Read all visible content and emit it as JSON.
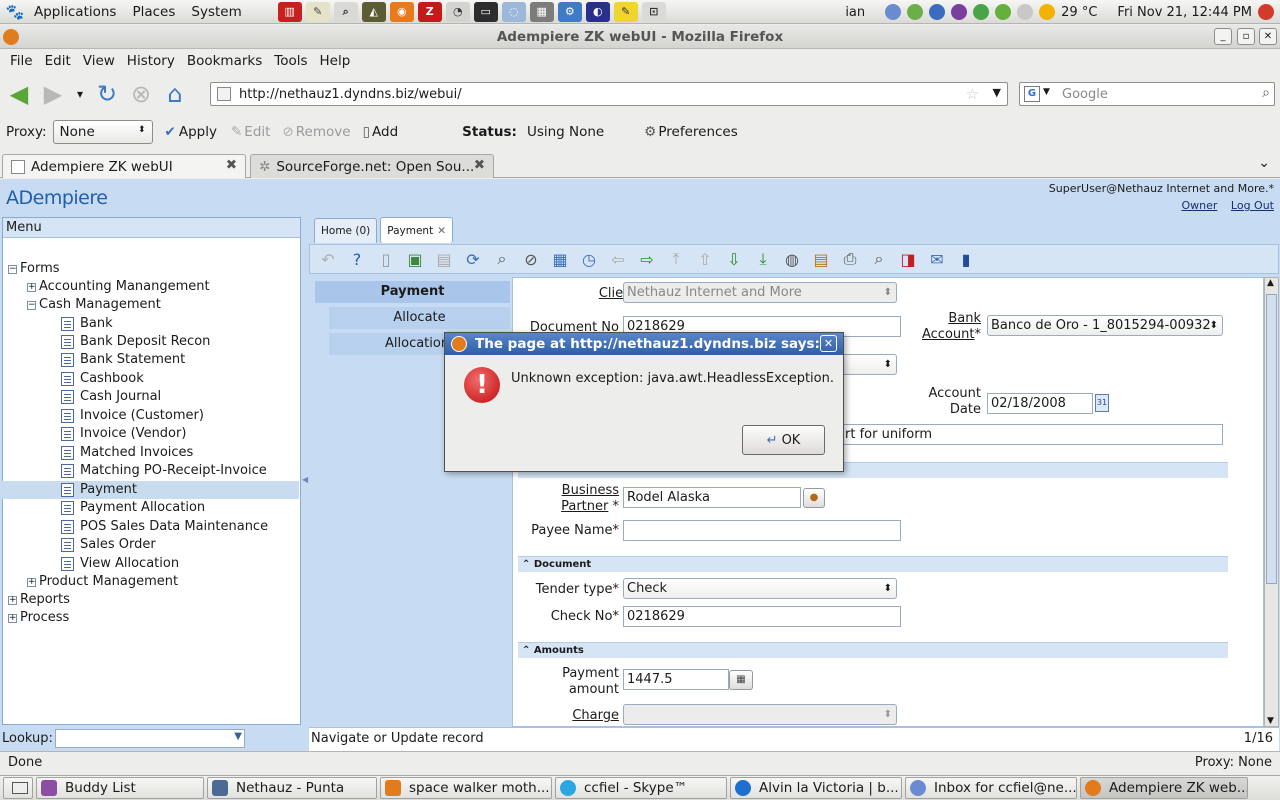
{
  "gnome_panel": {
    "menus": [
      "Applications",
      "Places",
      "System"
    ],
    "user": "ian",
    "weather": "29 °C",
    "clock": "Fri Nov 21, 12:44 PM"
  },
  "window": {
    "title": "Adempiere ZK webUI - Mozilla Firefox"
  },
  "firefox": {
    "menu": [
      "File",
      "Edit",
      "View",
      "History",
      "Bookmarks",
      "Tools",
      "Help"
    ],
    "url": "http://nethauz1.dyndns.biz/webui/",
    "search_placeholder": "Google",
    "proxy": {
      "label": "Proxy:",
      "value": "None",
      "apply": "Apply",
      "edit": "Edit",
      "remove": "Remove",
      "add": "Add",
      "status_label": "Status:",
      "status_value": "Using None",
      "preferences": "Preferences"
    },
    "tabs": [
      "Adempiere ZK webUI",
      "SourceForge.net: Open Sou..."
    ],
    "status_left": "Done",
    "status_right": "Proxy: None"
  },
  "adempiere": {
    "logo": "ADempiere",
    "user_line": "SuperUser@Nethauz Internet and More.*",
    "owner": "Owner",
    "logout": "Log Out",
    "menu_title": "Menu",
    "tree": {
      "forms": "Forms",
      "accounting": "Accounting Manangement",
      "cash": "Cash Management",
      "items": [
        "Bank",
        "Bank Deposit Recon",
        "Bank Statement",
        "Cashbook",
        "Cash Journal",
        "Invoice (Customer)",
        "Invoice (Vendor)",
        "Matched Invoices",
        "Matching PO-Receipt-Invoice",
        "Payment",
        "Payment Allocation",
        "POS Sales Data Maintenance",
        "Sales Order",
        "View Allocation"
      ],
      "product": "Product Management",
      "reports": "Reports",
      "process": "Process"
    },
    "lookup_label": "Lookup:",
    "tabs": [
      "Home (0)",
      "Payment"
    ],
    "left_tabs": [
      "Payment",
      "Allocate",
      "Allocation"
    ],
    "form": {
      "client_label": "Client",
      "client_value": "Nethauz Internet and More",
      "docno_label": "Document No",
      "docno_value": "0218629",
      "bank_label_1": "Bank",
      "bank_label_2": "Account",
      "bank_value": "Banco de Oro - 1_8015294-00932",
      "acct_label_1": "Account",
      "acct_label_2": "Date",
      "acct_value": "02/18/2008",
      "desc_value": "rt for uniform",
      "bp_label_1": "Business",
      "bp_label_2": "Partner",
      "bp_value": "Rodel Alaska",
      "payee_label": "Payee Name",
      "document_section": "Document",
      "tender_label": "Tender type",
      "tender_value": "Check",
      "checkno_label": "Check No",
      "checkno_value": "0218629",
      "amounts_section": "Amounts",
      "payamt_label_1": "Payment",
      "payamt_label_2": "amount",
      "payamt_value": "1447.5",
      "charge_label": "Charge"
    },
    "status_text": "Navigate or Update record",
    "record_count": "1/16"
  },
  "dialog": {
    "title": "The page at http://nethauz1.dyndns.biz says:",
    "message": "Unknown exception: java.awt.HeadlessException.",
    "ok": "OK"
  },
  "taskbar": [
    "Buddy List",
    "Nethauz - Punta",
    "space walker moth...",
    "ccfiel - Skype™",
    "Alvin la Victoria | b...",
    "Inbox for ccfiel@ne...",
    "Adempiere ZK web..."
  ]
}
